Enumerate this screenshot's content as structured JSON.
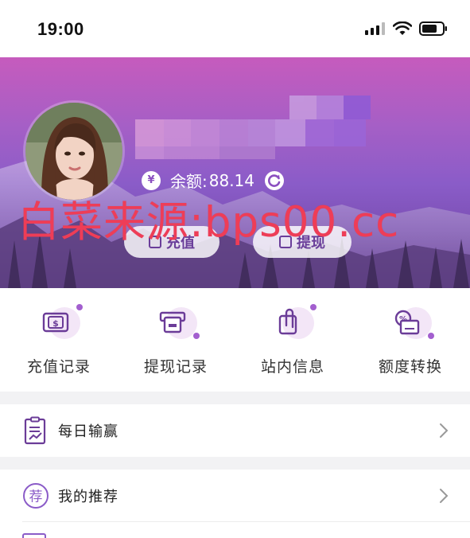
{
  "status_bar": {
    "time": "19:00"
  },
  "header": {
    "balance_currency_symbol": "¥",
    "balance_label": "余额:",
    "balance_value": "88.14",
    "recharge_label": "充值",
    "withdraw_label": "提现"
  },
  "watermark": "白菜来源:bps00.cc",
  "quick_actions": [
    {
      "label": "充值记录",
      "icon": "wallet-icon"
    },
    {
      "label": "提现记录",
      "icon": "atm-icon"
    },
    {
      "label": "站内信息",
      "icon": "clip-icon"
    },
    {
      "label": "额度转换",
      "icon": "percent-icon"
    }
  ],
  "menu": [
    {
      "label": "每日输赢",
      "icon": "report-icon"
    },
    {
      "label": "我的推荐",
      "icon": "recommend-icon",
      "icon_text": "荐"
    }
  ],
  "colors": {
    "accent": "#a35fcf",
    "watermark": "#ee3d57",
    "header_top": "#c65bbd",
    "header_bottom": "#5f3a86"
  }
}
